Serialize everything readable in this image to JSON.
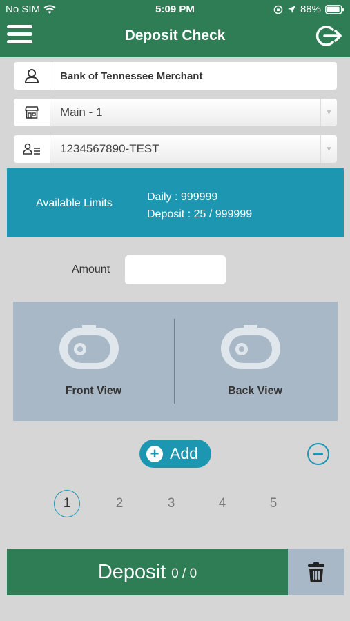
{
  "status_bar": {
    "carrier": "No SIM",
    "time": "5:09 PM",
    "battery": "88%"
  },
  "header": {
    "title": "Deposit Check"
  },
  "merchant": {
    "name": "Bank of Tennessee Merchant"
  },
  "location_select": {
    "value": "Main - 1"
  },
  "account_select": {
    "value": "1234567890-TEST"
  },
  "limits": {
    "label": "Available Limits",
    "daily": "Daily : 999999",
    "deposit": "Deposit : 25 / 999999"
  },
  "amount": {
    "label": "Amount",
    "value": ""
  },
  "capture": {
    "front_label": "Front View",
    "back_label": "Back View"
  },
  "add_label": "Add",
  "pagination": {
    "pages": [
      "1",
      "2",
      "3",
      "4",
      "5"
    ],
    "active": "1"
  },
  "footer": {
    "deposit_label": "Deposit",
    "deposit_count": "0 / 0"
  },
  "colors": {
    "brand_green": "#2e7d55",
    "accent_teal": "#1d96b2",
    "capture_panel": "#a8b8c6",
    "background": "#d6d6d6"
  },
  "icons": [
    "wifi-icon",
    "location-arrow-icon",
    "battery-icon",
    "menu-icon",
    "logout-icon",
    "user-icon",
    "store-icon",
    "account-list-icon",
    "camera-icon",
    "plus-icon",
    "minus-icon",
    "trash-icon"
  ]
}
